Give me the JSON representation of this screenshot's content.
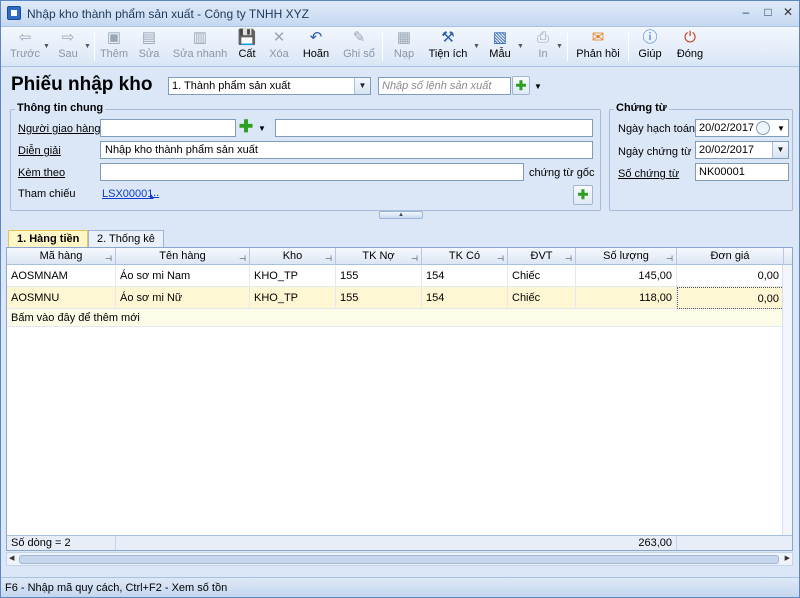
{
  "window": {
    "title": "Nhập kho thành phẩm sản xuất - Công ty TNHH XYZ",
    "minimize": "–",
    "maximize": "□",
    "close": "✕"
  },
  "toolbar": {
    "back": {
      "label": "Trước",
      "icon": "arrow-left-icon"
    },
    "next": {
      "label": "Sau",
      "icon": "arrow-right-icon"
    },
    "add": {
      "label": "Thêm",
      "icon": "add-doc-icon"
    },
    "edit": {
      "label": "Sửa",
      "icon": "edit-doc-icon"
    },
    "quick_edit": {
      "label": "Sửa nhanh",
      "icon": "quick-edit-icon"
    },
    "save": {
      "label": "Cất",
      "icon": "floppy-icon"
    },
    "delete": {
      "label": "Xóa",
      "icon": "delete-icon"
    },
    "undo": {
      "label": "Hoãn",
      "icon": "undo-icon"
    },
    "post": {
      "label": "Ghi sổ",
      "icon": "pencil-icon"
    },
    "load": {
      "label": "Nạp",
      "icon": "load-icon"
    },
    "utilities": {
      "label": "Tiện ích",
      "icon": "tools-icon"
    },
    "template": {
      "label": "Mẫu",
      "icon": "template-icon"
    },
    "print": {
      "label": "In",
      "icon": "printer-icon"
    },
    "feedback": {
      "label": "Phản hồi",
      "icon": "envelope-icon"
    },
    "help": {
      "label": "Giúp",
      "icon": "help-icon"
    },
    "close": {
      "label": "Đóng",
      "icon": "power-icon"
    }
  },
  "header": {
    "title": "Phiếu nhập kho",
    "type_select": "1. Thành phẩm sản xuất",
    "order_placeholder": "Nhập số lệnh sản xuất"
  },
  "general": {
    "group_title": "Thông tin chung",
    "deliverer_label": "Người giao hàng",
    "deliverer_value": "",
    "deliverer_name": "",
    "description_label": "Diễn giải",
    "description_value": "Nhập kho thành phẩm sản xuất",
    "attach_label": "Kèm theo",
    "attach_value": "",
    "attach_suffix": "chứng từ gốc",
    "reference_label": "Tham chiếu",
    "reference_value": "LSX00001",
    "reference_more": "..."
  },
  "voucher": {
    "group_title": "Chứng từ",
    "accounting_date_label": "Ngày hạch toán",
    "accounting_date": "20/02/2017",
    "voucher_date_label": "Ngày chứng từ",
    "voucher_date": "20/02/2017",
    "voucher_no_label": "Số chứng từ",
    "voucher_no": "NK00001"
  },
  "tabs": [
    {
      "label": "1. Hàng tiền",
      "active": true
    },
    {
      "label": "2. Thống kê",
      "active": false
    }
  ],
  "grid": {
    "columns": [
      "Mã hàng",
      "Tên hàng",
      "Kho",
      "TK Nợ",
      "TK Có",
      "ĐVT",
      "Số lượng",
      "Đơn giá"
    ],
    "rows": [
      [
        "AOSMNAM",
        "Áo sơ mi Nam",
        "KHO_TP",
        "155",
        "154",
        "Chiếc",
        "145,00",
        "0,00"
      ],
      [
        "AOSMNU",
        "Áo sơ mi Nữ",
        "KHO_TP",
        "155",
        "154",
        "Chiếc",
        "118,00",
        "0,00"
      ]
    ],
    "add_row_text": "Bấm vào đây để thêm mới",
    "footer_count": "Số dòng = 2",
    "footer_total_qty": "263,00"
  },
  "status": {
    "text": "F6 - Nhập mã quy cách, Ctrl+F2 - Xem số tồn"
  },
  "colors": {
    "window_bg": "#dbe7f7",
    "selected_row": "#fff7d4",
    "link": "#0b3bd1",
    "active_tab": "#fff7c8"
  }
}
